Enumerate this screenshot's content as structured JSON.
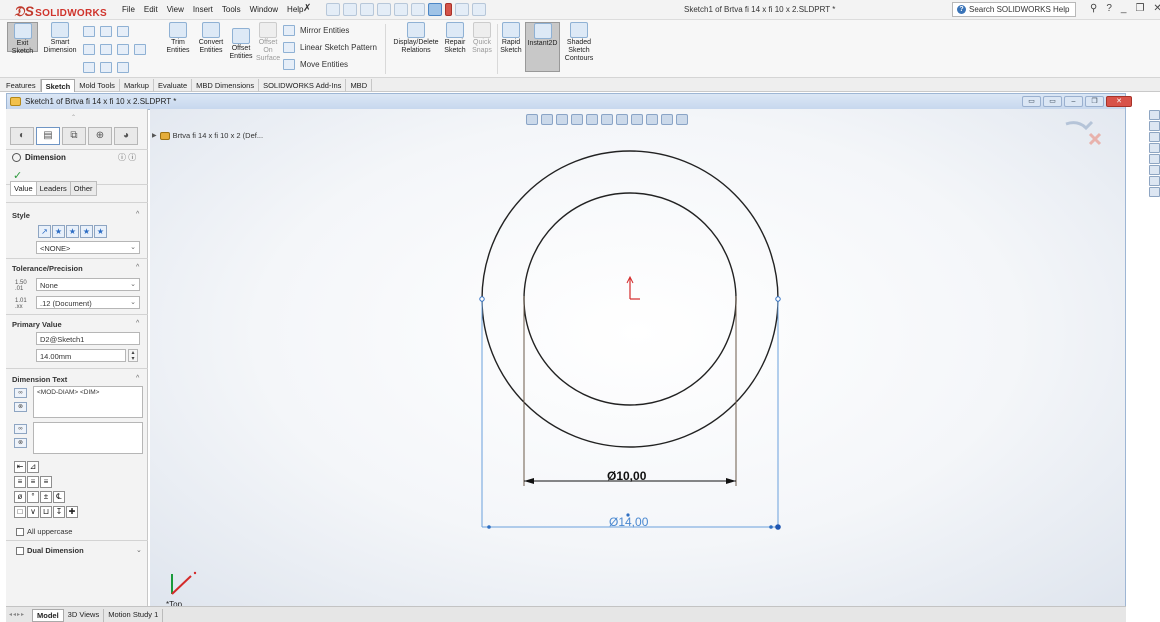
{
  "app": {
    "brand": "SOLIDWORKS",
    "menus": [
      "File",
      "Edit",
      "View",
      "Insert",
      "Tools",
      "Window",
      "Help"
    ],
    "document_title": "Sketch1 of Brtva fi 14 x fi 10 x 2.SLDPRT *",
    "help_search_placeholder": "Search SOLIDWORKS Help"
  },
  "command_manager": {
    "exit_sketch": "Exit Sketch",
    "smart_dimension": "Smart Dimension",
    "trim_entities": "Trim Entities",
    "convert_entities": "Convert Entities",
    "offset_entities": "Offset Entities",
    "offset_on_surface": "Offset On Surface",
    "mirror_entities": "Mirror Entities",
    "linear_sketch_pattern": "Linear Sketch Pattern",
    "move_entities": "Move Entities",
    "display_delete_relations": "Display/Delete Relations",
    "repair_sketch": "Repair Sketch",
    "quick_snaps": "Quick Snaps",
    "rapid_sketch": "Rapid Sketch",
    "instant2d": "Instant2D",
    "shaded_sketch_contours": "Shaded Sketch Contours"
  },
  "tabs": [
    "Features",
    "Sketch",
    "Mold Tools",
    "Markup",
    "Evaluate",
    "MBD Dimensions",
    "SOLIDWORKS Add-Ins",
    "MBD"
  ],
  "active_tab": "Sketch",
  "doc_window": {
    "title": "Sketch1 of Brtva fi 14 x fi 10 x 2.SLDPRT *"
  },
  "property_manager": {
    "title": "Dimension",
    "subtabs": [
      "Value",
      "Leaders",
      "Other"
    ],
    "style": {
      "title": "Style",
      "value": "<NONE>"
    },
    "tolerance": {
      "title": "Tolerance/Precision",
      "tolerance_value": "None",
      "precision_value": ".12 (Document)"
    },
    "primary_value": {
      "title": "Primary Value",
      "name": "D2@Sketch1",
      "value": "14.00mm"
    },
    "dimension_text": {
      "title": "Dimension Text",
      "text": "<MOD-DIAM> <DIM>"
    },
    "all_uppercase": "All uppercase",
    "dual_dimension": "Dual Dimension"
  },
  "tree": {
    "part_name": "Brtva fi 14 x fi 10 x 2 (Def..."
  },
  "sketch": {
    "inner_dimension": "Ø10,00",
    "outer_dimension": "Ø14,00",
    "view_name": "*Top"
  },
  "bottom_tabs": [
    "Model",
    "3D Views",
    "Motion Study 1"
  ],
  "active_bottom_tab": "Model"
}
